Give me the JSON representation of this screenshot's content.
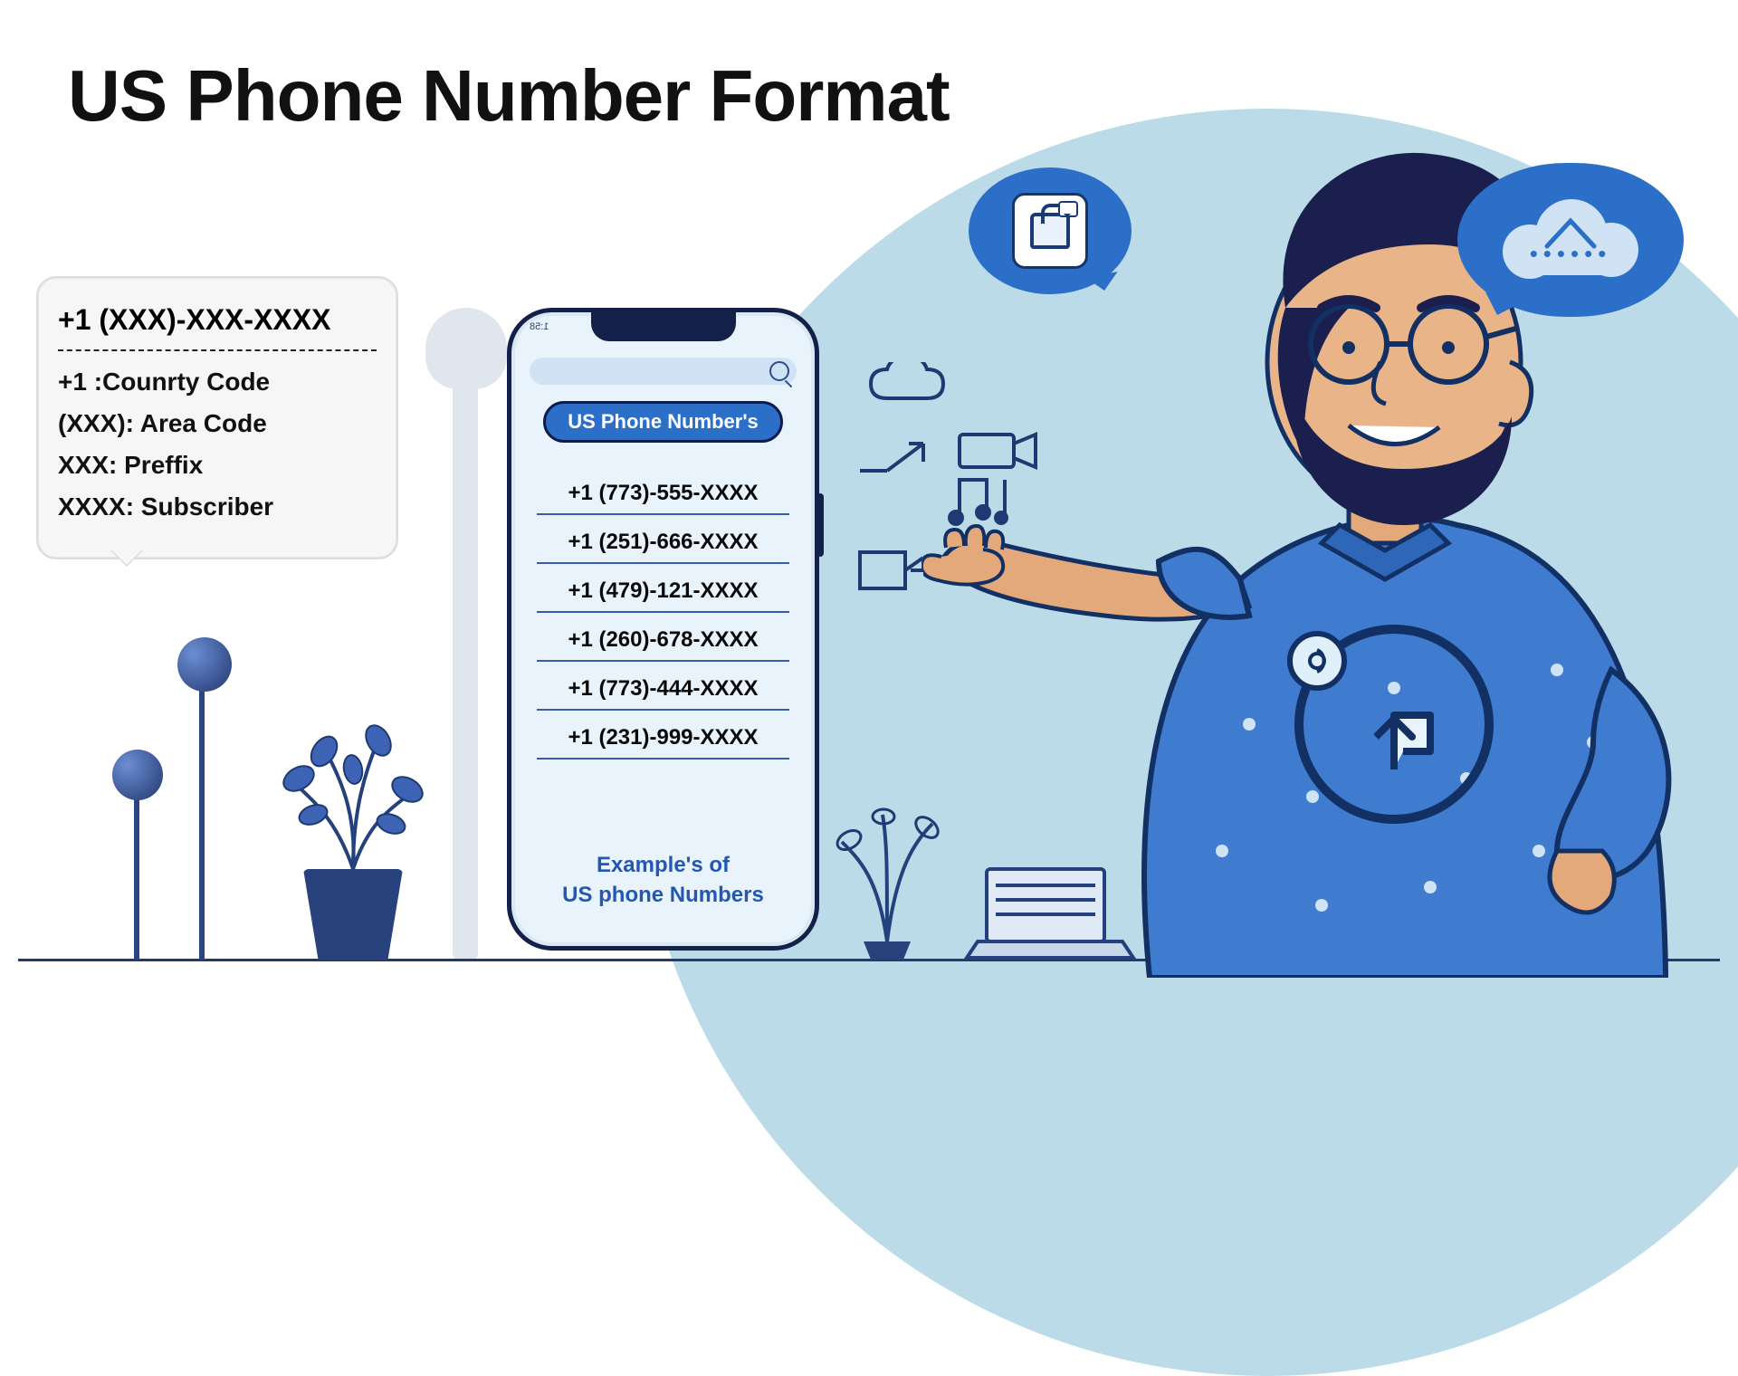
{
  "title": "US Phone Number Format",
  "callout": {
    "format_line": "+1 (XXX)-XXX-XXXX",
    "legend": [
      "+1 :Counrty Code",
      "(XXX): Area Code",
      "XXX: Preffix",
      "XXXX: Subscriber"
    ]
  },
  "phone": {
    "header_pill": "US Phone Number's",
    "examples": [
      "+1 (773)-555-XXXX",
      "+1 (251)-666-XXXX",
      "+1 (479)-121-XXXX",
      "+1 (260)-678-XXXX",
      "+1 (773)-444-XXXX",
      "+1 (231)-999-XXXX"
    ],
    "example_label_line1": "Example's of",
    "example_label_line2": "US phone Numbers"
  },
  "colors": {
    "primary_blue": "#2b6fc9",
    "navy": "#13214a",
    "light": "#cfe3f4",
    "skin": "#e4a97a"
  }
}
